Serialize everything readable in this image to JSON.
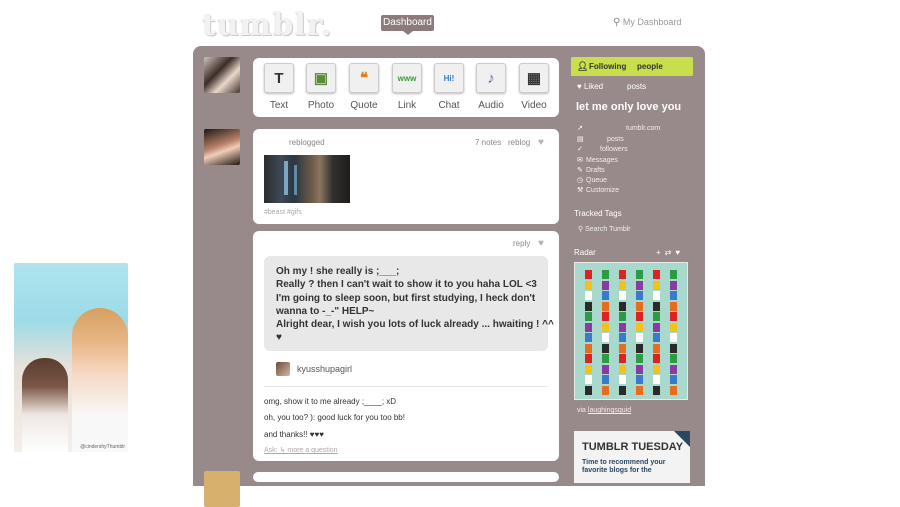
{
  "header": {
    "logo": "tumblr.",
    "dashboard_button": "Dashboard",
    "search_link": "My Dashboard"
  },
  "side_photo": {
    "watermark": "@cindershyThumblr"
  },
  "post_types": [
    {
      "label": "Text",
      "glyph": "T",
      "color": "#333333"
    },
    {
      "label": "Photo",
      "glyph": "▣",
      "color": "#5a8a3a"
    },
    {
      "label": "Quote",
      "glyph": "❝",
      "color": "#e08020"
    },
    {
      "label": "Link",
      "glyph": "www",
      "color": "#3b9a3b"
    },
    {
      "label": "Chat",
      "glyph": "Hi!",
      "color": "#3a7cc0"
    },
    {
      "label": "Audio",
      "glyph": "♪",
      "color": "#8a5aa0"
    },
    {
      "label": "Video",
      "glyph": "▦",
      "color": "#444444"
    }
  ],
  "post1": {
    "reblogged": "reblogged",
    "notes": "7 notes",
    "reblog": "reblog",
    "tags": "#beast  #gifs"
  },
  "post2": {
    "reply": "reply",
    "question_lines": [
      "Oh my ! she really is ;___;",
      "Really ? then I can't wait to show it to you haha LOL <3",
      "I'm going to sleep soon, but first studying, I heck don't",
      "wanna to -_-\" HELP~",
      "Alright dear, I wish you lots of luck already ... hwaiting ! ^^",
      "♥"
    ],
    "asker": "kyusshupagirl",
    "answers": [
      "omg, show it to me already ;____; xD",
      "oh, you too? ): good luck for you too bb!",
      "and thanks!! ♥♥♥"
    ],
    "ask_link": "Ask: ↳ more a question"
  },
  "sidebar": {
    "following_label": "Following",
    "following_suffix": "people",
    "liked": "Liked",
    "liked_posts": "posts",
    "blog_title": "let me only love you",
    "links": {
      "url": "tumblr.com",
      "posts": "posts",
      "followers": "followers",
      "messages": "Messages",
      "drafts": "Drafts",
      "queue": "Queue",
      "customize": "Customize"
    },
    "tracked_tags": "Tracked Tags",
    "search_tumblr": "Search Tumblr",
    "radar": "Radar",
    "via_prefix": "via",
    "via_user": "laughingsquid",
    "tumblr_tuesday_title": "TUMBLR TUESDAY",
    "tumblr_tuesday_body": "Time to recommend your favorite blogs for the"
  },
  "colors": {
    "panel": "#98898a",
    "accent_following": "#c9de4c",
    "radar_bg": "#a9d8cc"
  }
}
